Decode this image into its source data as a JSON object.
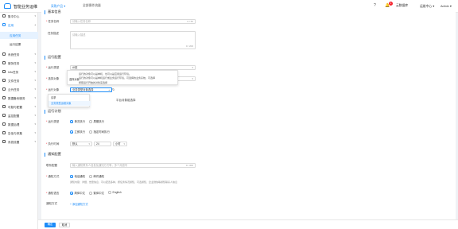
{
  "app": {
    "title": "智能业务运维",
    "nav": [
      "采购产品 ▾",
      "全部操作流量"
    ],
    "badge": "1",
    "header_links": [
      "云数据库",
      "运维中心 ▾",
      "Admin ▾"
    ]
  },
  "sidebar": {
    "items": [
      {
        "label": "集中中心",
        "chev": "▾"
      },
      {
        "label": "应用",
        "chev": "▴"
      },
      {
        "label": "应用任务"
      },
      {
        "label": "运行结果"
      },
      {
        "label": "系统任务",
        "chev": "▾"
      },
      {
        "label": "服务任务",
        "chev": "▾"
      },
      {
        "label": "Info任务",
        "chev": "▾"
      },
      {
        "label": "文件任务",
        "chev": "▾"
      },
      {
        "label": "云代任务",
        "chev": "▾"
      },
      {
        "label": "数据备份服务",
        "chev": "▾"
      },
      {
        "label": "可疑与配置",
        "chev": "▾"
      },
      {
        "label": "监控配置",
        "chev": "▾"
      },
      {
        "label": "数据治理",
        "chev": "▾"
      },
      {
        "label": "告信与采集",
        "chev": "▾"
      },
      {
        "label": "系统设置",
        "chev": "▾"
      }
    ]
  },
  "basic": {
    "title": "基本信息",
    "name_label": "任务名称",
    "name_placeholder": "请输入任务名称",
    "name_counter": "0 / 50",
    "desc_label": "任务描述",
    "desc_placeholder": "请输入描述",
    "desc_counter": "0 / 200"
  },
  "exec": {
    "title": "运行配置",
    "type_label": "运行类型",
    "type_value": "AI型",
    "obj_label": "选择对象",
    "target_label": "运行对象",
    "target_value": "业务类型对象选择",
    "target_suffix": "平台对象组选择",
    "tooltip": {
      "label": "选择对象",
      "lines": [
        "运行的对象可以是单机、也可以是应用运行环境。",
        "运行的对象可以是单机运行或业务运行环境，可选择的业务系统，可选择",
        "按照运行开始的对象来选择"
      ]
    },
    "dropdown": [
      "请求",
      "业务类型运维对象"
    ]
  },
  "schedule": {
    "title": "运行计划",
    "type_label": "运行类型",
    "options_a": [
      "单次执行",
      "周期执行"
    ],
    "options_b": [
      "立即执行",
      "指定时间执行"
    ],
    "time_label": "执行时间",
    "time_value": "默认",
    "hour_value": "24",
    "unit_value": "小时"
  },
  "notify": {
    "title": "通知配置",
    "label1": "联系配置",
    "placeholder1": "输入通知联系人信息及通知方式等，多个用逗号",
    "counter1": "0 / 300",
    "label2": "通知方式",
    "method_options": [
      "电话通知",
      "邮件通知"
    ],
    "method_hint": "通知内容：详细、告警信息、可以配置多种、按任务情况通知，可选通知、企业微信等通知联系人信息",
    "label3": "通知语言",
    "lang_options": [
      "简体中文",
      "繁体中文",
      "English"
    ],
    "label4": "通知方式",
    "add_link": "+ 添加通知方式"
  },
  "footer": {
    "confirm": "确定",
    "cancel": "取消"
  },
  "colors": {
    "accent": "#1d8cf8",
    "danger": "#f5222d"
  }
}
